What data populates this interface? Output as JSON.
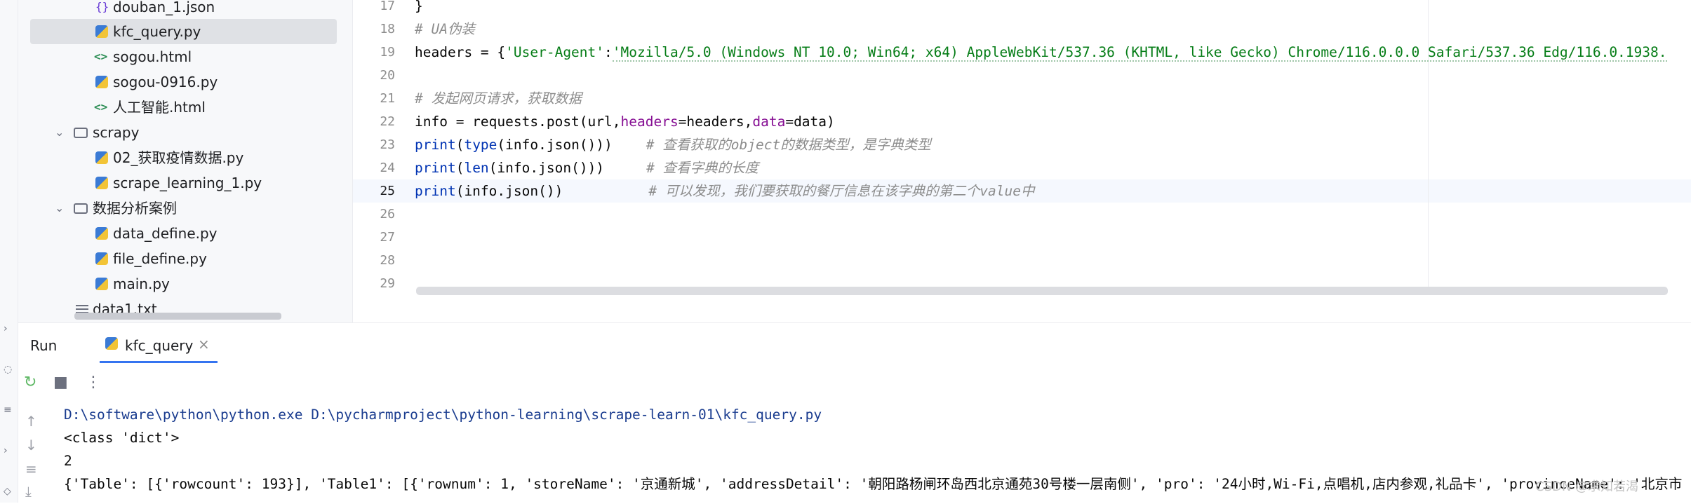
{
  "project": {
    "items": [
      {
        "label": "douban_1.json",
        "icon": "json-icon"
      },
      {
        "label": "kfc_query.py",
        "icon": "python-file-icon"
      },
      {
        "label": "sogou.html",
        "icon": "html-file-icon"
      },
      {
        "label": "sogou-0916.py",
        "icon": "python-file-icon"
      },
      {
        "label": "人工智能.html",
        "icon": "html-file-icon"
      },
      {
        "label": "scrapy",
        "icon": "folder-icon"
      },
      {
        "label": "02_获取疫情数据.py",
        "icon": "python-file-icon"
      },
      {
        "label": "scrape_learning_1.py",
        "icon": "python-file-icon"
      },
      {
        "label": "数据分析案例",
        "icon": "folder-icon"
      },
      {
        "label": "data_define.py",
        "icon": "python-file-icon"
      },
      {
        "label": "file_define.py",
        "icon": "python-file-icon"
      },
      {
        "label": "main.py",
        "icon": "python-file-icon"
      },
      {
        "label": "data1.txt",
        "icon": "text-file-icon"
      }
    ],
    "selected": "kfc_query.py"
  },
  "editor": {
    "line_numbers": [
      "17",
      "18",
      "19",
      "20",
      "21",
      "22",
      "23",
      "24",
      "25",
      "26",
      "27",
      "28",
      "29"
    ],
    "current_line": "25",
    "lines": {
      "l17": "}",
      "l18_comment": "# UA伪装",
      "l19_a": "headers = {",
      "l19_key": "'User-Agent'",
      "l19_colon": ":",
      "l19_val": "'Mozilla/5.0 (Windows NT 10.0; Win64; x64) AppleWebKit/537.36 (KHTML, like Gecko) Chrome/116.0.0.0 Safari/537.36 Edg/116.0.1938.",
      "l21_comment": "# 发起网页请求，获取数据",
      "l22_a": "info = requests.post(url,",
      "l22_p1": "headers",
      "l22_b": "=headers,",
      "l22_p2": "data",
      "l22_c": "=data)",
      "l23_fn": "print",
      "l23_a": "(",
      "l23_fn2": "type",
      "l23_b": "(info.json()))",
      "l23_comment": "# 查看获取的object的数据类型，是字典类型",
      "l24_fn": "print",
      "l24_a": "(",
      "l24_fn2": "len",
      "l24_b": "(info.json()))",
      "l24_comment": "# 查看字典的长度",
      "l25_fn": "print",
      "l25_b": "(info.json())",
      "l25_comment": "# 可以发现，我们要获取的餐厅信息在该字典的第二个value中"
    }
  },
  "run": {
    "title": "Run",
    "tab_label": "kfc_query",
    "output": [
      "D:\\software\\python\\python.exe D:\\pycharmproject\\python-learning\\scrape-learn-01\\kfc_query.py",
      "<class 'dict'>",
      "2",
      "{'Table': [{'rowcount': 193}], 'Table1': [{'rownum': 1, 'storeName': '京通新城', 'addressDetail': '朝阳路杨闸环岛西北京通苑30号楼一层南侧', 'pro': '24小时,Wi-Fi,点唱机,店内参观,礼品卡', 'provinceName': '北京市"
    ]
  },
  "watermark": "CSDN @求知若渴"
}
